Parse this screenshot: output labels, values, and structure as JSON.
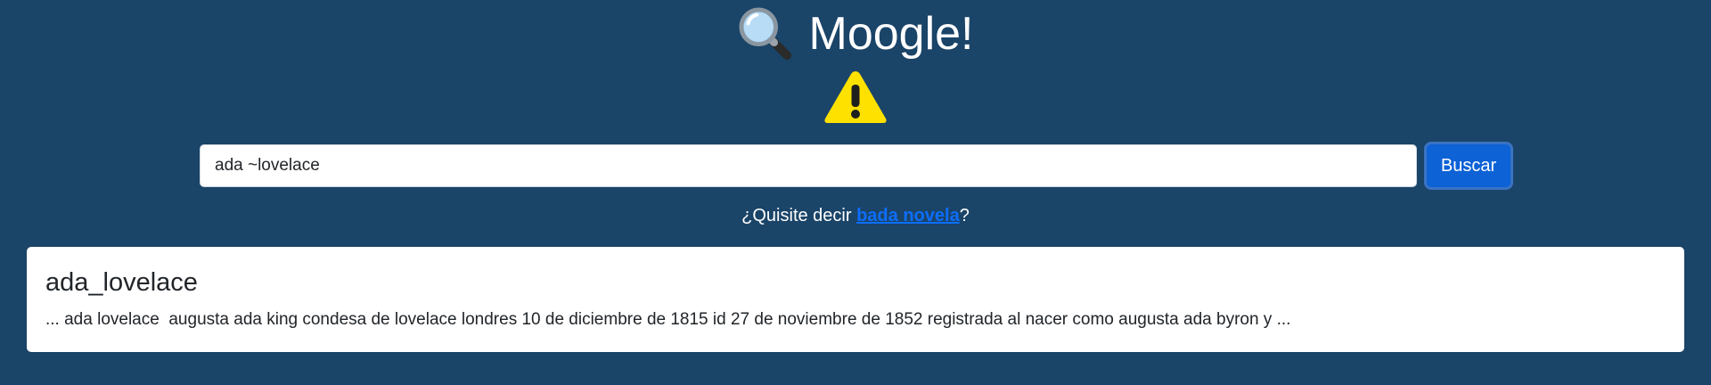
{
  "header": {
    "title": "Moogle!",
    "icon": "magnifying-glass-icon"
  },
  "warning": {
    "icon": "warning-icon",
    "color": "#ffe100"
  },
  "search": {
    "value": "ada ~lovelace",
    "button_label": "Buscar"
  },
  "suggestion": {
    "prefix": "¿Quisite decir ",
    "link_text": "bada novela",
    "suffix": "?"
  },
  "results": [
    {
      "title": "ada_lovelace",
      "snippet": "... ada lovelace  augusta ada king condesa de lovelace londres 10 de diciembre de 1815 id 27 de noviembre de 1852 registrada al nacer como augusta ada byron y ..."
    }
  ],
  "colors": {
    "background": "#1a4468",
    "button": "#0d62d6",
    "link": "#0d6efd"
  }
}
